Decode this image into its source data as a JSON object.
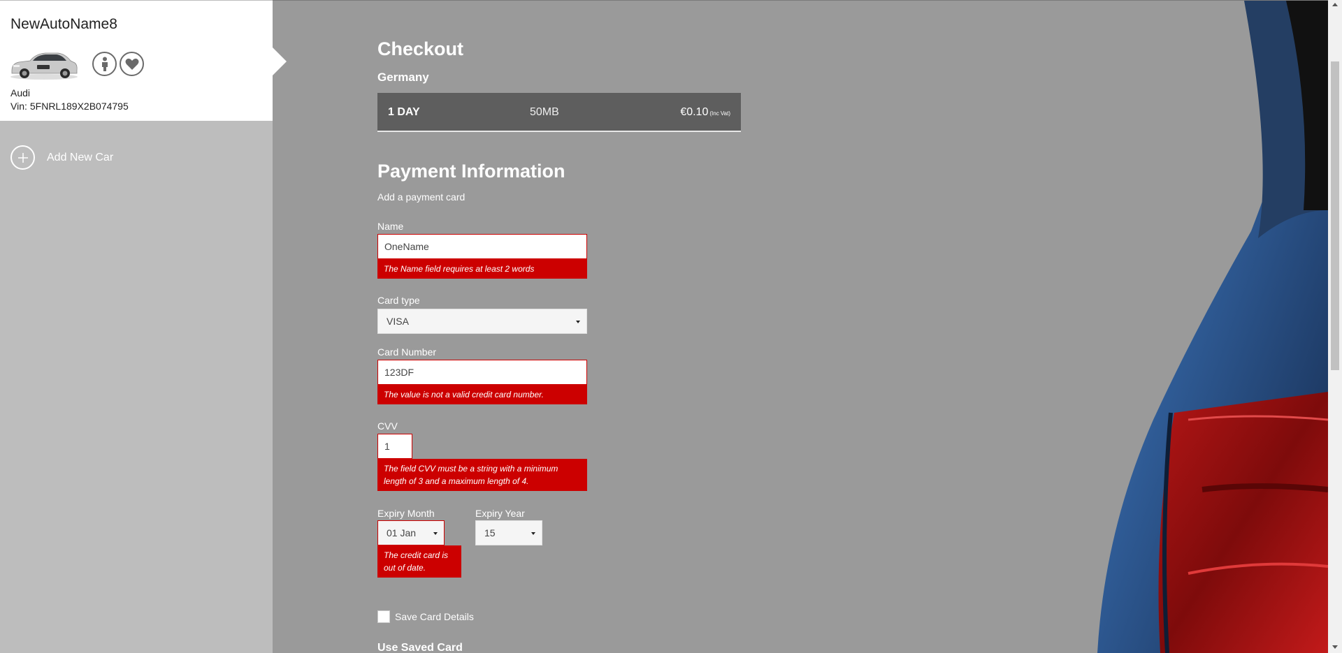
{
  "sidebar": {
    "car": {
      "name": "NewAutoName8",
      "make": "Audi",
      "vin_label": "Vin:",
      "vin": "5FNRL189X2B074795"
    },
    "add_car_label": "Add New Car"
  },
  "checkout": {
    "title": "Checkout",
    "country": "Germany",
    "plan": {
      "duration": "1 DAY",
      "data": "50MB",
      "price": "€0.10",
      "vat_note": "(Inc Vat)"
    }
  },
  "payment": {
    "title": "Payment Information",
    "subtitle": "Add a payment card",
    "name": {
      "label": "Name",
      "value": "OneName",
      "error": "The Name field requires at least 2 words"
    },
    "card_type": {
      "label": "Card type",
      "value": "VISA"
    },
    "card_number": {
      "label": "Card Number",
      "value": "123DF",
      "error": "The value is not a valid credit card number."
    },
    "cvv": {
      "label": "CVV",
      "value": "1",
      "error": "The field CVV must be a string with a minimum length of 3 and a maximum length of 4."
    },
    "expiry_month": {
      "label": "Expiry Month",
      "value": "01 Jan",
      "error": "The credit card is out of date."
    },
    "expiry_year": {
      "label": "Expiry Year",
      "value": "15"
    },
    "save_card_label": "Save Card Details",
    "saved_card_title": "Use Saved Card"
  },
  "colors": {
    "error_red": "#cc0000",
    "background": "#9a9a9a",
    "sidebar": "#bdbdbd",
    "plan_bar": "#5e5e5e"
  }
}
